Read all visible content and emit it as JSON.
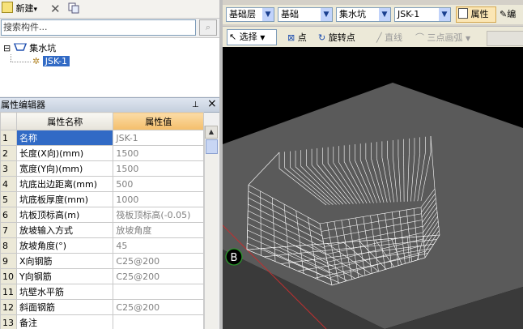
{
  "left_toolbar": {
    "new_label": "新建",
    "new_dropdown": "▾",
    "delete_icon": "close-icon",
    "copy_icon": "copy-icon"
  },
  "search": {
    "placeholder": "搜索构件..."
  },
  "tree": {
    "root": {
      "label": "集水坑",
      "expander": "⊟"
    },
    "child": {
      "label": "JSK-1"
    }
  },
  "property_panel": {
    "title": "属性编辑器",
    "pin": "📌",
    "close": "×",
    "col_name": "属性名称",
    "col_value": "属性值",
    "rows": [
      {
        "num": "1",
        "name": "名称",
        "value": "JSK-1"
      },
      {
        "num": "2",
        "name": "长度(X向)(mm)",
        "value": "1500"
      },
      {
        "num": "3",
        "name": "宽度(Y向)(mm)",
        "value": "1500"
      },
      {
        "num": "4",
        "name": "坑底出边距离(mm)",
        "value": "500"
      },
      {
        "num": "5",
        "name": "坑底板厚度(mm)",
        "value": "1000"
      },
      {
        "num": "6",
        "name": "坑板顶标高(m)",
        "value": "筏板顶标高(-0.05)"
      },
      {
        "num": "7",
        "name": "放坡输入方式",
        "value": "放坡角度"
      },
      {
        "num": "8",
        "name": "放坡角度(°)",
        "value": "45"
      },
      {
        "num": "9",
        "name": "X向钢筋",
        "value": "C25@200"
      },
      {
        "num": "10",
        "name": "Y向钢筋",
        "value": "C25@200"
      },
      {
        "num": "11",
        "name": "坑壁水平筋",
        "value": ""
      },
      {
        "num": "12",
        "name": "斜面钢筋",
        "value": "C25@200"
      },
      {
        "num": "13",
        "name": "备注",
        "value": ""
      }
    ]
  },
  "toolbar1": {
    "layer": "基础层",
    "category": "基础",
    "type": "集水坑",
    "element": "JSK-1",
    "properties_label": "属性",
    "edit_label": "编"
  },
  "toolbar2": {
    "select_label": "选择",
    "point_label": "点",
    "rotate_point_label": "旋转点",
    "line_label": "直线",
    "arc_label": "三点画弧"
  },
  "viewport": {
    "axis_label": "B"
  },
  "colors": {
    "selection": "#316ac5",
    "value_header": "#f4be6a",
    "slab": "#5c5c5c",
    "wire": "#ffffff"
  }
}
